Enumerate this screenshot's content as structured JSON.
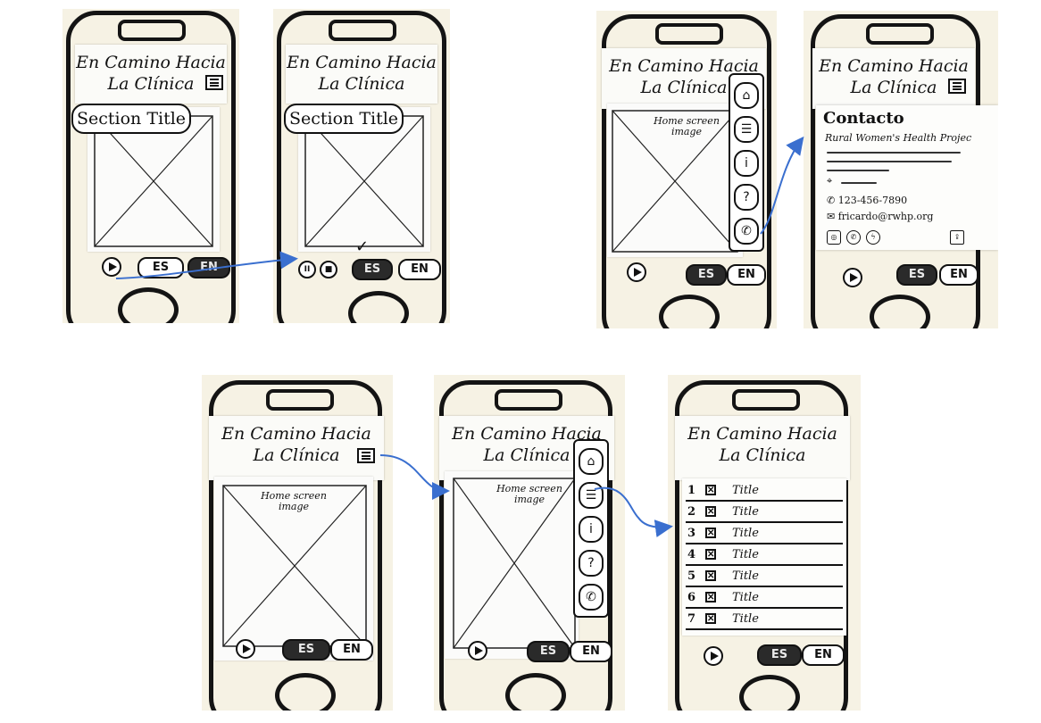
{
  "header": {
    "line1": "En Camino Hacia",
    "line2": "La Clínica"
  },
  "section_title": "Section Title",
  "image_label": "Home screen image",
  "lang": {
    "es": "ES",
    "en": "EN"
  },
  "audio": {
    "pause": "II",
    "stop": "■",
    "selected_mark": "✓"
  },
  "side_menu": [
    {
      "icon": "home-icon",
      "glyph": "⌂"
    },
    {
      "icon": "list-icon",
      "glyph": "☰"
    },
    {
      "icon": "info-icon",
      "glyph": "i"
    },
    {
      "icon": "help-icon",
      "glyph": "?"
    },
    {
      "icon": "phone-icon",
      "glyph": "✆"
    }
  ],
  "contact": {
    "title": "Contacto",
    "org": "Rural Women's Health Projec",
    "phone": "123-456-7890",
    "email": "fricardo@rwhp.org"
  },
  "list": {
    "items": [
      {
        "num": "1",
        "title": "Title"
      },
      {
        "num": "2",
        "title": "Title"
      },
      {
        "num": "3",
        "title": "Title"
      },
      {
        "num": "4",
        "title": "Title"
      },
      {
        "num": "5",
        "title": "Title"
      },
      {
        "num": "6",
        "title": "Title"
      },
      {
        "num": "7",
        "title": "Title"
      }
    ]
  },
  "colors": {
    "paper": "#f6f2e4",
    "ink": "#141414",
    "arrow": "#3a6fcf"
  }
}
